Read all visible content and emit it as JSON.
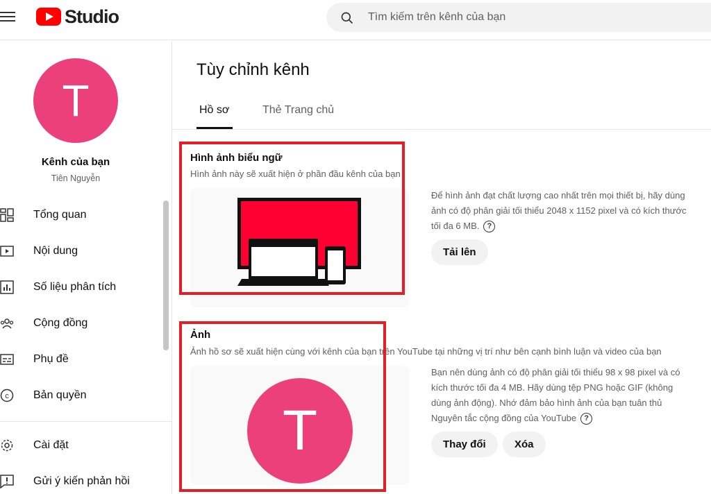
{
  "header": {
    "logo_text": "Studio",
    "search_placeholder": "Tìm kiếm trên kênh của bạn"
  },
  "sidebar": {
    "avatar_letter": "T",
    "channel_title": "Kênh của bạn",
    "channel_owner": "Tiên Nguyễn",
    "items": [
      {
        "label": "Tổng quan",
        "icon": "dashboard-icon"
      },
      {
        "label": "Nội dung",
        "icon": "content-icon"
      },
      {
        "label": "Số liệu phân tích",
        "icon": "analytics-icon"
      },
      {
        "label": "Cộng đồng",
        "icon": "community-icon"
      },
      {
        "label": "Phụ đề",
        "icon": "subtitles-icon"
      },
      {
        "label": "Bản quyền",
        "icon": "copyright-icon"
      },
      {
        "label": "Cài đặt",
        "icon": "settings-icon"
      },
      {
        "label": "Gửi ý kiến phản hồi",
        "icon": "feedback-icon"
      }
    ]
  },
  "main": {
    "page_title": "Tùy chỉnh kênh",
    "tabs": [
      {
        "label": "Hồ sơ",
        "active": true
      },
      {
        "label": "Thẻ Trang chủ",
        "active": false
      }
    ],
    "banner": {
      "title": "Hình ảnh biểu ngữ",
      "description": "Hình ảnh này sẽ xuất hiện ở phần đầu kênh của bạn",
      "info": "Để hình ảnh đạt chất lượng cao nhất trên mọi thiết bị, hãy dùng ảnh có độ phân giải tối thiểu 2048 x 1152 pixel và có kích thước tối đa 6 MB.",
      "upload_label": "Tải lên"
    },
    "photo": {
      "title": "Ảnh",
      "description": "Ảnh hồ sơ sẽ xuất hiện cùng với kênh của bạn trên YouTube tại những vị trí như bên cạnh bình luận và video của bạn",
      "avatar_letter": "T",
      "info": "Bạn nên dùng ảnh có độ phân giải tối thiểu 98 x 98 pixel và có kích thước tối đa 4 MB. Hãy dùng tệp PNG hoặc GIF (không dùng ảnh động). Nhớ đảm bảo hình ảnh của bạn tuân thủ Nguyên tắc cộng đồng của YouTube",
      "change_label": "Thay đổi",
      "delete_label": "Xóa"
    }
  },
  "colors": {
    "brand_red": "#ff0000",
    "avatar_pink": "#ec407a",
    "highlight_red": "#e21f26"
  }
}
